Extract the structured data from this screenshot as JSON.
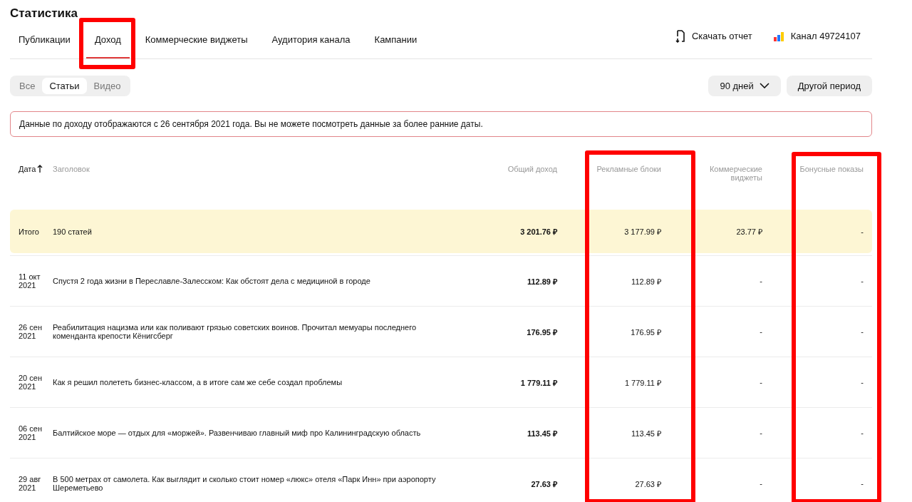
{
  "page": {
    "title": "Статистика"
  },
  "tabs": [
    {
      "label": "Публикации",
      "selected": false
    },
    {
      "label": "Доход",
      "selected": true
    },
    {
      "label": "Коммерческие виджеты",
      "selected": false
    },
    {
      "label": "Аудитория канала",
      "selected": false
    },
    {
      "label": "Кампании",
      "selected": false
    }
  ],
  "actions": {
    "download": "Скачать отчет",
    "channel": "Канал 49724107"
  },
  "content_filter": [
    {
      "label": "Все",
      "selected": false
    },
    {
      "label": "Статьи",
      "selected": true
    },
    {
      "label": "Видео",
      "selected": false
    }
  ],
  "period": {
    "dropdown": "90 дней",
    "custom": "Другой период"
  },
  "notice": "Данные по доходу отображаются с 26 сентября 2021 года. Вы не можете посмотреть данные за более ранние даты.",
  "table": {
    "columns": [
      {
        "label": "Дата",
        "sorted": true
      },
      {
        "label": "Заголовок",
        "sorted": false
      },
      {
        "label": "Общий доход",
        "sorted": false
      },
      {
        "label": "Рекламные блоки",
        "sorted": false
      },
      {
        "label": "Коммерческие виджеты",
        "sorted": false
      },
      {
        "label": "Бонусные показы",
        "sorted": false
      }
    ],
    "rows": [
      {
        "kind": "total",
        "cells": [
          "Итого",
          "190 статей",
          "3 201.76 ₽",
          "3 177.99 ₽",
          "23.77 ₽",
          "-"
        ]
      },
      {
        "kind": "article",
        "cells": [
          "11 окт 2021",
          "Спустя 2 года жизни в Переславле-Залесском: Как обстоят дела с медициной в городе",
          "112.89 ₽",
          "112.89 ₽",
          "-",
          "-"
        ]
      },
      {
        "kind": "article",
        "cells": [
          "26 сен 2021",
          "Реабилитация нацизма или как поливают грязью советских воинов. Прочитал мемуары последнего коменданта крепости Кёнигсберг",
          "176.95 ₽",
          "176.95 ₽",
          "-",
          "-"
        ]
      },
      {
        "kind": "article",
        "cells": [
          "20 сен 2021",
          "Как я решил полететь бизнес-классом, а в итоге сам же себе создал проблемы",
          "1 779.11 ₽",
          "1 779.11 ₽",
          "-",
          "-"
        ]
      },
      {
        "kind": "article",
        "cells": [
          "06 сен 2021",
          "Балтийское море — отдых для «моржей». Развенчиваю главный миф про Калининградскую область",
          "113.45 ₽",
          "113.45 ₽",
          "-",
          "-"
        ]
      },
      {
        "kind": "article",
        "cells": [
          "29 авг 2021",
          "В 500 метрах от самолета. Как выглядит и сколько стоит номер «люкс» отеля «Парк Инн» при аэропорту Шереметьево",
          "27.63 ₽",
          "27.63 ₽",
          "-",
          "-"
        ]
      }
    ]
  }
}
